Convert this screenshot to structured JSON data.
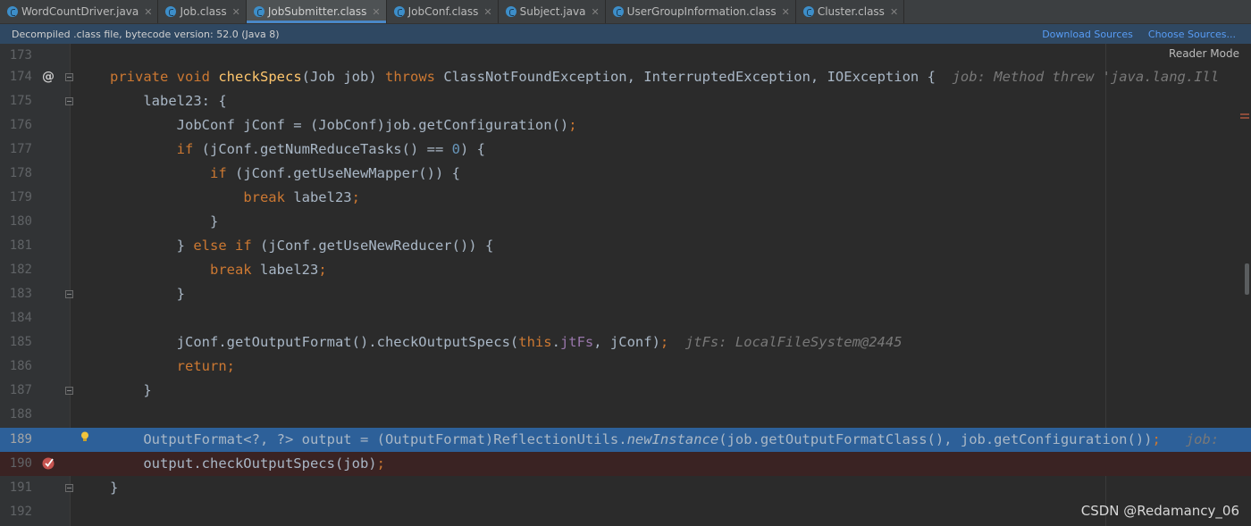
{
  "tabs": [
    {
      "label": "WordCountDriver.java"
    },
    {
      "label": "Job.class"
    },
    {
      "label": "JobSubmitter.class"
    },
    {
      "label": "JobConf.class"
    },
    {
      "label": "Subject.java"
    },
    {
      "label": "UserGroupInformation.class"
    },
    {
      "label": "Cluster.class"
    }
  ],
  "active_tab": "JobSubmitter.class",
  "banner": {
    "text": "Decompiled .class file, bytecode version: 52.0 (Java 8)",
    "download_sources": "Download Sources",
    "choose_sources": "Choose Sources..."
  },
  "editor": {
    "reader_mode": "Reader Mode",
    "lines": {
      "l173": "173",
      "l174": "174",
      "l175": "175",
      "l176": "176",
      "l177": "177",
      "l178": "178",
      "l179": "179",
      "l180": "180",
      "l181": "181",
      "l182": "182",
      "l183": "183",
      "l184": "184",
      "l185": "185",
      "l186": "186",
      "l187": "187",
      "l188": "188",
      "l189": "189",
      "l190": "190",
      "l191": "191",
      "l192": "192"
    },
    "code": {
      "c174": {
        "private": "private",
        "void": "void",
        "name": "checkSpecs",
        "params": "(Job job) ",
        "throws": "throws",
        "rest": " ClassNotFoundException, InterruptedException, IOException {  ",
        "hint": "job: Method threw 'java.lang.Ill"
      },
      "c175": "label23: {",
      "c176a": "JobConf jConf = (JobConf)job.getConfiguration()",
      "c176b": ";",
      "c177": {
        "if": "if",
        "mid": " (jConf.getNumReduceTasks() == ",
        "num": "0",
        "end": ") {"
      },
      "c178": {
        "if": "if",
        "rest": " (jConf.getUseNewMapper()) {"
      },
      "c179": {
        "break": "break",
        "label": " label23",
        "semi": ";"
      },
      "c180": "}",
      "c181": {
        "pre": "} ",
        "else": "else",
        "sp": " ",
        "if": "if",
        "rest": " (jConf.getUseNewReducer()) {"
      },
      "c182": {
        "break": "break",
        "label": " label23",
        "semi": ";"
      },
      "c183": "}",
      "c185": {
        "pre": "jConf.getOutputFormat().checkOutputSpecs(",
        "this": "this",
        "dot": ".",
        "field": "jtFs",
        "post": ", jConf)",
        "semi": ";",
        "hint": "  jtFs: LocalFileSystem@2445"
      },
      "c186": {
        "ret": "return",
        "semi": ";"
      },
      "c187": "}",
      "c189": {
        "pre": "OutputFormat<?, ?> output = (OutputFormat)ReflectionUtils.",
        "method": "newInstance",
        "post": "(job.getOutputFormatClass(), job.getConfiguration())",
        "semi": ";",
        "hint": "   job:"
      },
      "c190": {
        "pre": "output.checkOutputSpecs(job)",
        "semi": ";"
      },
      "c191": "}"
    }
  },
  "watermark": "CSDN @Redamancy_06",
  "colors": {
    "keyword": "#cc7832",
    "method": "#ffc66d",
    "number": "#6897bb",
    "field": "#9876aa",
    "exec_line": "#2d6099",
    "breakpoint_line": "#3a2323",
    "breakpoint": "#c75450"
  },
  "icons": {
    "gutter_174": "override-at-icon",
    "gutter_189": "lightbulb-icon",
    "gutter_190": "breakpoint-check-icon"
  }
}
